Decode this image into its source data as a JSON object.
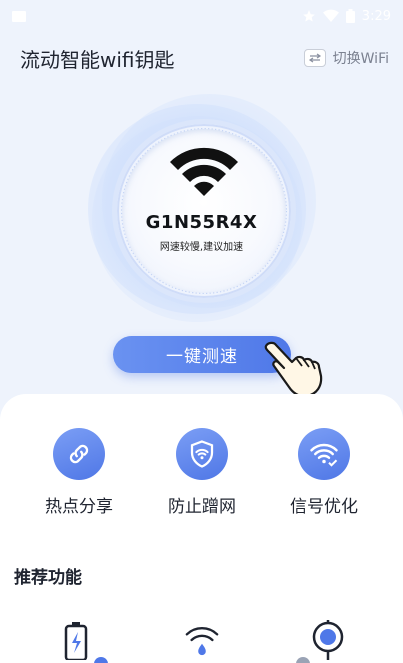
{
  "status_bar": {
    "time": "3:29"
  },
  "header": {
    "title": "流动智能wifi钥匙",
    "switch_label": "切换WiFi"
  },
  "gauge": {
    "ssid": "G1N55R4X",
    "tip": "网速较慢,建议加速"
  },
  "speed_button": {
    "label": "一键测速"
  },
  "quick_actions": [
    {
      "label": "热点分享",
      "icon": "link-icon"
    },
    {
      "label": "防止蹭网",
      "icon": "shield-wifi-icon"
    },
    {
      "label": "信号优化",
      "icon": "wifi-check-icon"
    }
  ],
  "recommend": {
    "title": "推荐功能",
    "items": [
      {
        "icon": "battery-charging-icon"
      },
      {
        "icon": "wifi-drop-icon"
      },
      {
        "icon": "location-target-icon"
      }
    ]
  },
  "colors": {
    "accent": "#4f78e8",
    "background": "#eef3fc",
    "panel": "#ffffff"
  }
}
